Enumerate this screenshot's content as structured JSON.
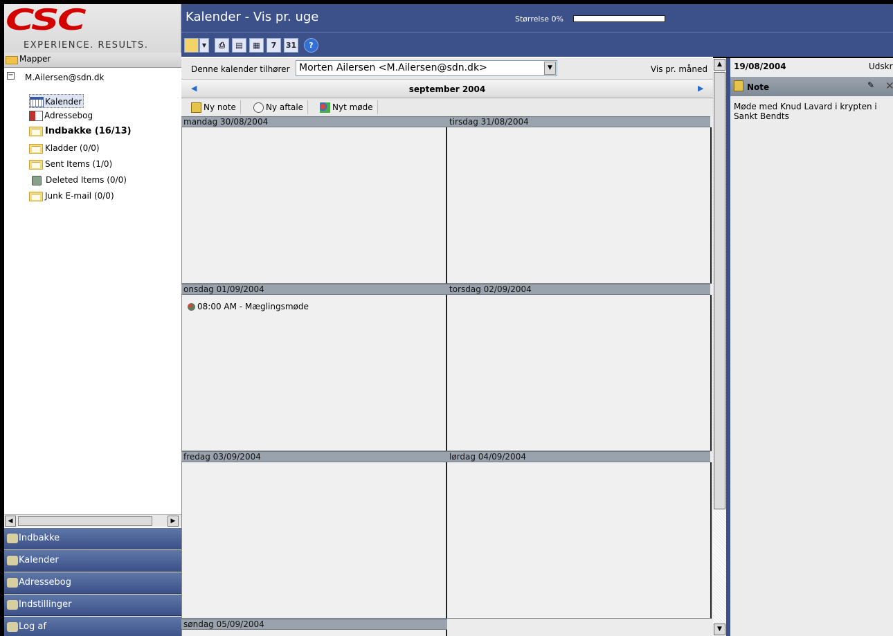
{
  "logo": {
    "brand": "CSC",
    "tagline": "EXPERIENCE. RESULTS."
  },
  "folders_header": "Mapper",
  "tree": {
    "account": "M.Ailersen@sdn.dk",
    "items": [
      {
        "label": "Kalender",
        "icon": "calendar-icon",
        "bold": false,
        "selected": true
      },
      {
        "label": "Adressebog",
        "icon": "address-book-icon",
        "bold": false
      },
      {
        "label": "Indbakke (16/13)",
        "icon": "folder-mail-icon",
        "bold": true
      },
      {
        "label": "Kladder (0/0)",
        "icon": "folder-mail-icon",
        "bold": false
      },
      {
        "label": "Sent Items (1/0)",
        "icon": "folder-mail-icon",
        "bold": false
      },
      {
        "label": "Deleted Items (0/0)",
        "icon": "trash-icon",
        "bold": false
      },
      {
        "label": "Junk E-mail (0/0)",
        "icon": "folder-mail-icon",
        "bold": false
      }
    ]
  },
  "nav": [
    {
      "label": "Indbakke",
      "icon": "inbox-nav-icon"
    },
    {
      "label": "Kalender",
      "icon": "calendar-nav-icon"
    },
    {
      "label": "Adressebog",
      "icon": "address-book-nav-icon"
    },
    {
      "label": "Indstillinger",
      "icon": "settings-nav-icon"
    },
    {
      "label": "Log af",
      "icon": "logout-nav-icon"
    }
  ],
  "header": {
    "title": "Kalender - Vis pr. uge",
    "size_label": "Størrelse 0%",
    "size_percent": 0
  },
  "toolbar": {
    "icons": [
      "new-note-icon",
      "dropdown-icon",
      "print-icon",
      "day-view-icon",
      "week-view-icon",
      "workweek-7-icon",
      "month-31-icon",
      "help-icon"
    ],
    "workweek_label": "7",
    "month_label": "31",
    "help_label": "?"
  },
  "owner_bar": {
    "label": "Denne kalender tilhører",
    "selected_owner": "Morten Ailersen <M.Ailersen@sdn.dk>",
    "view_month_link": "Vis pr. måned"
  },
  "month_nav": {
    "month": "september 2004",
    "prev": "◀",
    "next": "▶"
  },
  "actions": {
    "new_note": "Ny note",
    "new_appointment": "Ny aftale",
    "new_meeting": "Nyt møde"
  },
  "days": [
    {
      "header": "mandag 30/08/2004",
      "appointments": []
    },
    {
      "header": "tirsdag 31/08/2004",
      "appointments": []
    },
    {
      "header": "onsdag 01/09/2004",
      "appointments": [
        "08:00 AM - Mæglingsmøde"
      ]
    },
    {
      "header": "torsdag 02/09/2004",
      "appointments": []
    },
    {
      "header": "fredag 03/09/2004",
      "appointments": []
    },
    {
      "header": "lørdag 04/09/2004",
      "appointments": []
    },
    {
      "header": "søndag 05/09/2004",
      "appointments": []
    }
  ],
  "right_panel": {
    "date": "19/08/2004",
    "print_label": "Udskriv",
    "note_title": "Note",
    "note_text": "Møde med Knud Lavard i krypten i Sankt Bendts"
  }
}
